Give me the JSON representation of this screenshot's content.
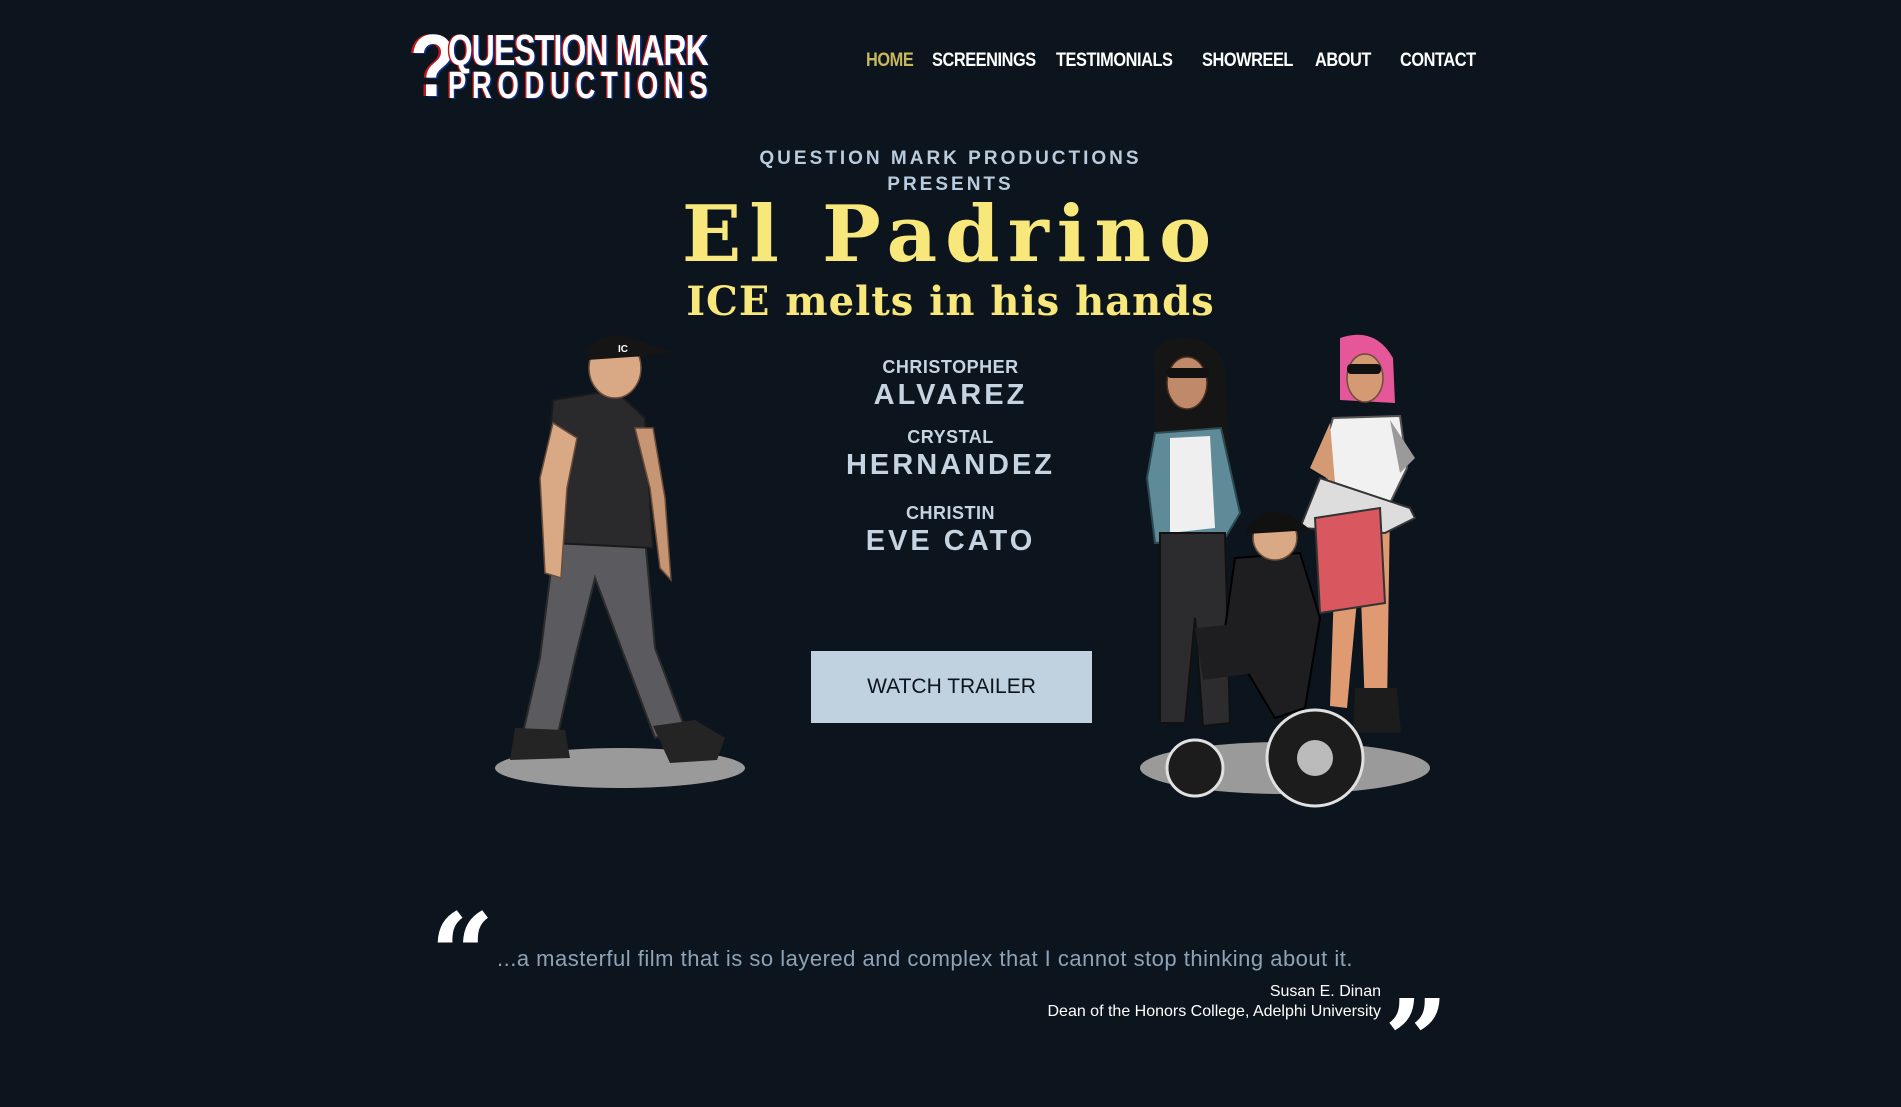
{
  "logo": {
    "mark": "?",
    "line1": "QUESTION MARK",
    "line2": "PRODUCTIONS"
  },
  "nav": {
    "items": [
      {
        "label": "HOME",
        "active": true
      },
      {
        "label": "SCREENINGS",
        "active": false
      },
      {
        "label": "TESTIMONIALS",
        "active": false
      },
      {
        "label": "SHOWREEL",
        "active": false
      },
      {
        "label": "ABOUT",
        "active": false
      },
      {
        "label": "CONTACT",
        "active": false
      }
    ]
  },
  "hero": {
    "presents_line1": "QUESTION MARK PRODUCTIONS",
    "presents_line2": "PRESENTS",
    "title": "El Padrino",
    "tagline": "ICE melts in his hands",
    "cast": [
      {
        "first": "CHRISTOPHER",
        "last": "ALVAREZ"
      },
      {
        "first": "CRYSTAL",
        "last": "HERNANDEZ"
      },
      {
        "first": "CHRISTIN",
        "last": "EVE CATO"
      }
    ],
    "cta_label": "WATCH TRAILER",
    "cap_text": "IC"
  },
  "testimonial": {
    "quote": "...a masterful film that is so layered and complex that I cannot stop thinking about it.",
    "author": "Susan E. Dinan",
    "role": "Dean of the Honors College, Adelphi University",
    "open_mark": "“",
    "close_mark": "”"
  },
  "colors": {
    "background": "#0c151d",
    "accent_yellow": "#f8e77a",
    "nav_active": "#c9b75d",
    "button_bg": "#c0d1e0",
    "cast_text": "#c6d3e0",
    "quote_text": "#8ea3b6"
  }
}
